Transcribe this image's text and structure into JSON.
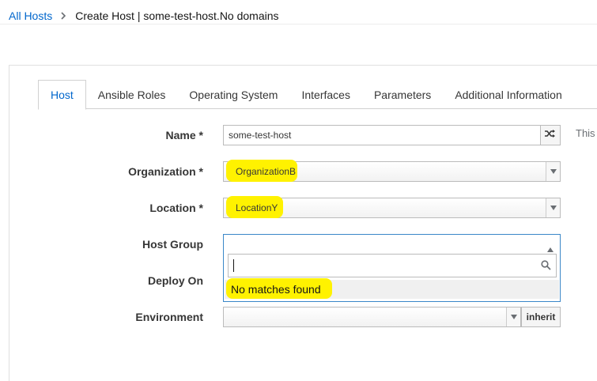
{
  "breadcrumb": {
    "root_label": "All Hosts",
    "current_label": "Create Host | some-test-host.No domains"
  },
  "tabs": [
    {
      "label": "Host",
      "active": true
    },
    {
      "label": "Ansible Roles",
      "active": false
    },
    {
      "label": "Operating System",
      "active": false
    },
    {
      "label": "Interfaces",
      "active": false
    },
    {
      "label": "Parameters",
      "active": false
    },
    {
      "label": "Additional Information",
      "active": false
    }
  ],
  "form": {
    "name": {
      "label": "Name *",
      "value": "some-test-host",
      "help_text": "This"
    },
    "organization": {
      "label": "Organization *",
      "value": "OrganizationB"
    },
    "location": {
      "label": "Location *",
      "value": "LocationY"
    },
    "host_group": {
      "label": "Host Group",
      "value": "",
      "search_value": "",
      "no_results_text": "No matches found"
    },
    "deploy_on": {
      "label": "Deploy On"
    },
    "environment": {
      "label": "Environment",
      "value": "",
      "inherit_label": "inherit"
    }
  },
  "icons": {
    "breadcrumb_separator": "chevron-right-icon",
    "name_generate": "shuffle-icon",
    "select_arrow": "triangle-down-icon",
    "open_select_arrow": "triangle-up-icon",
    "search": "search-icon"
  },
  "colors": {
    "link": "#0066cc",
    "highlight": "#fff200",
    "focus_border": "#3a87c8"
  }
}
